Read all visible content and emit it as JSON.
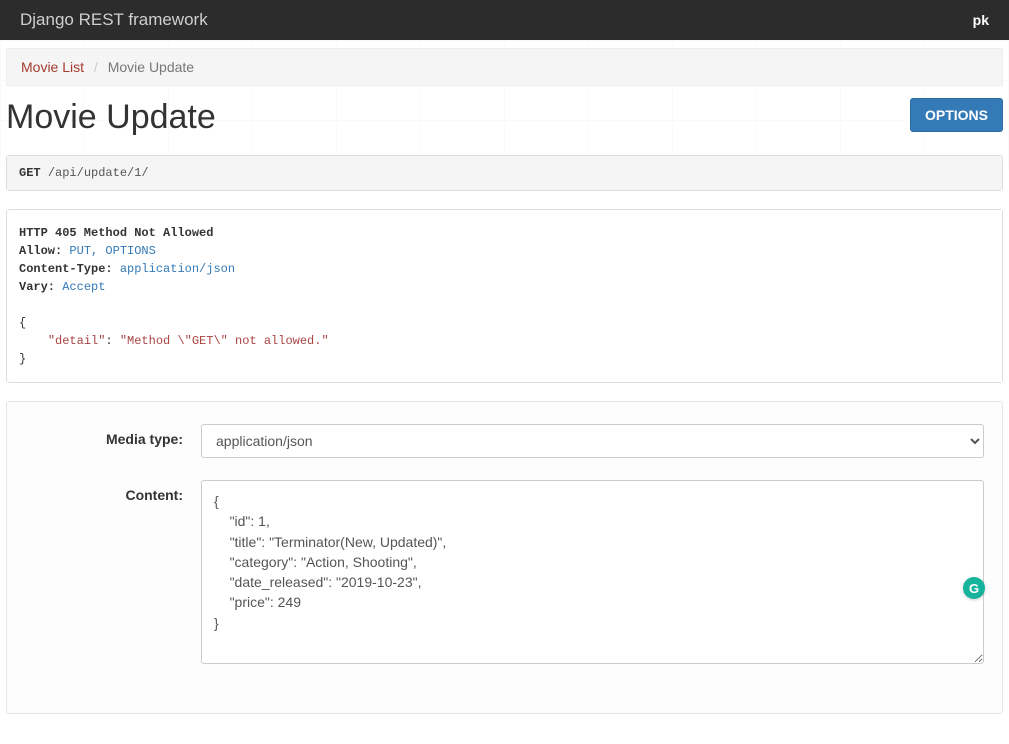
{
  "navbar": {
    "brand": "Django REST framework",
    "user": "pk"
  },
  "breadcrumb": {
    "items": [
      {
        "label": "Movie List",
        "link": true
      },
      {
        "label": "Movie Update",
        "link": false
      }
    ]
  },
  "header": {
    "title": "Movie Update",
    "options_button": "OPTIONS"
  },
  "request": {
    "method": "GET",
    "path": "/api/update/1/"
  },
  "response": {
    "status_line": "HTTP 405 Method Not Allowed",
    "headers": [
      {
        "name": "Allow",
        "value": "PUT, OPTIONS",
        "link_style": true
      },
      {
        "name": "Content-Type",
        "value": "application/json",
        "link_style": true
      },
      {
        "name": "Vary",
        "value": "Accept",
        "link_style": true
      }
    ],
    "body_json": {
      "keys": [
        "\"detail\""
      ],
      "values": [
        "\"Method \\\"GET\\\" not allowed.\""
      ]
    }
  },
  "form": {
    "media_type": {
      "label": "Media type:",
      "value": "application/json",
      "options": [
        "application/json"
      ]
    },
    "content": {
      "label": "Content:",
      "value": "{\n    \"id\": 1,\n    \"title\": \"Terminator(New, Updated)\",\n    \"category\": \"Action, Shooting\",\n    \"date_released\": \"2019-10-23\",\n    \"price\": 249\n}"
    }
  },
  "float_button": {
    "label": "G"
  }
}
